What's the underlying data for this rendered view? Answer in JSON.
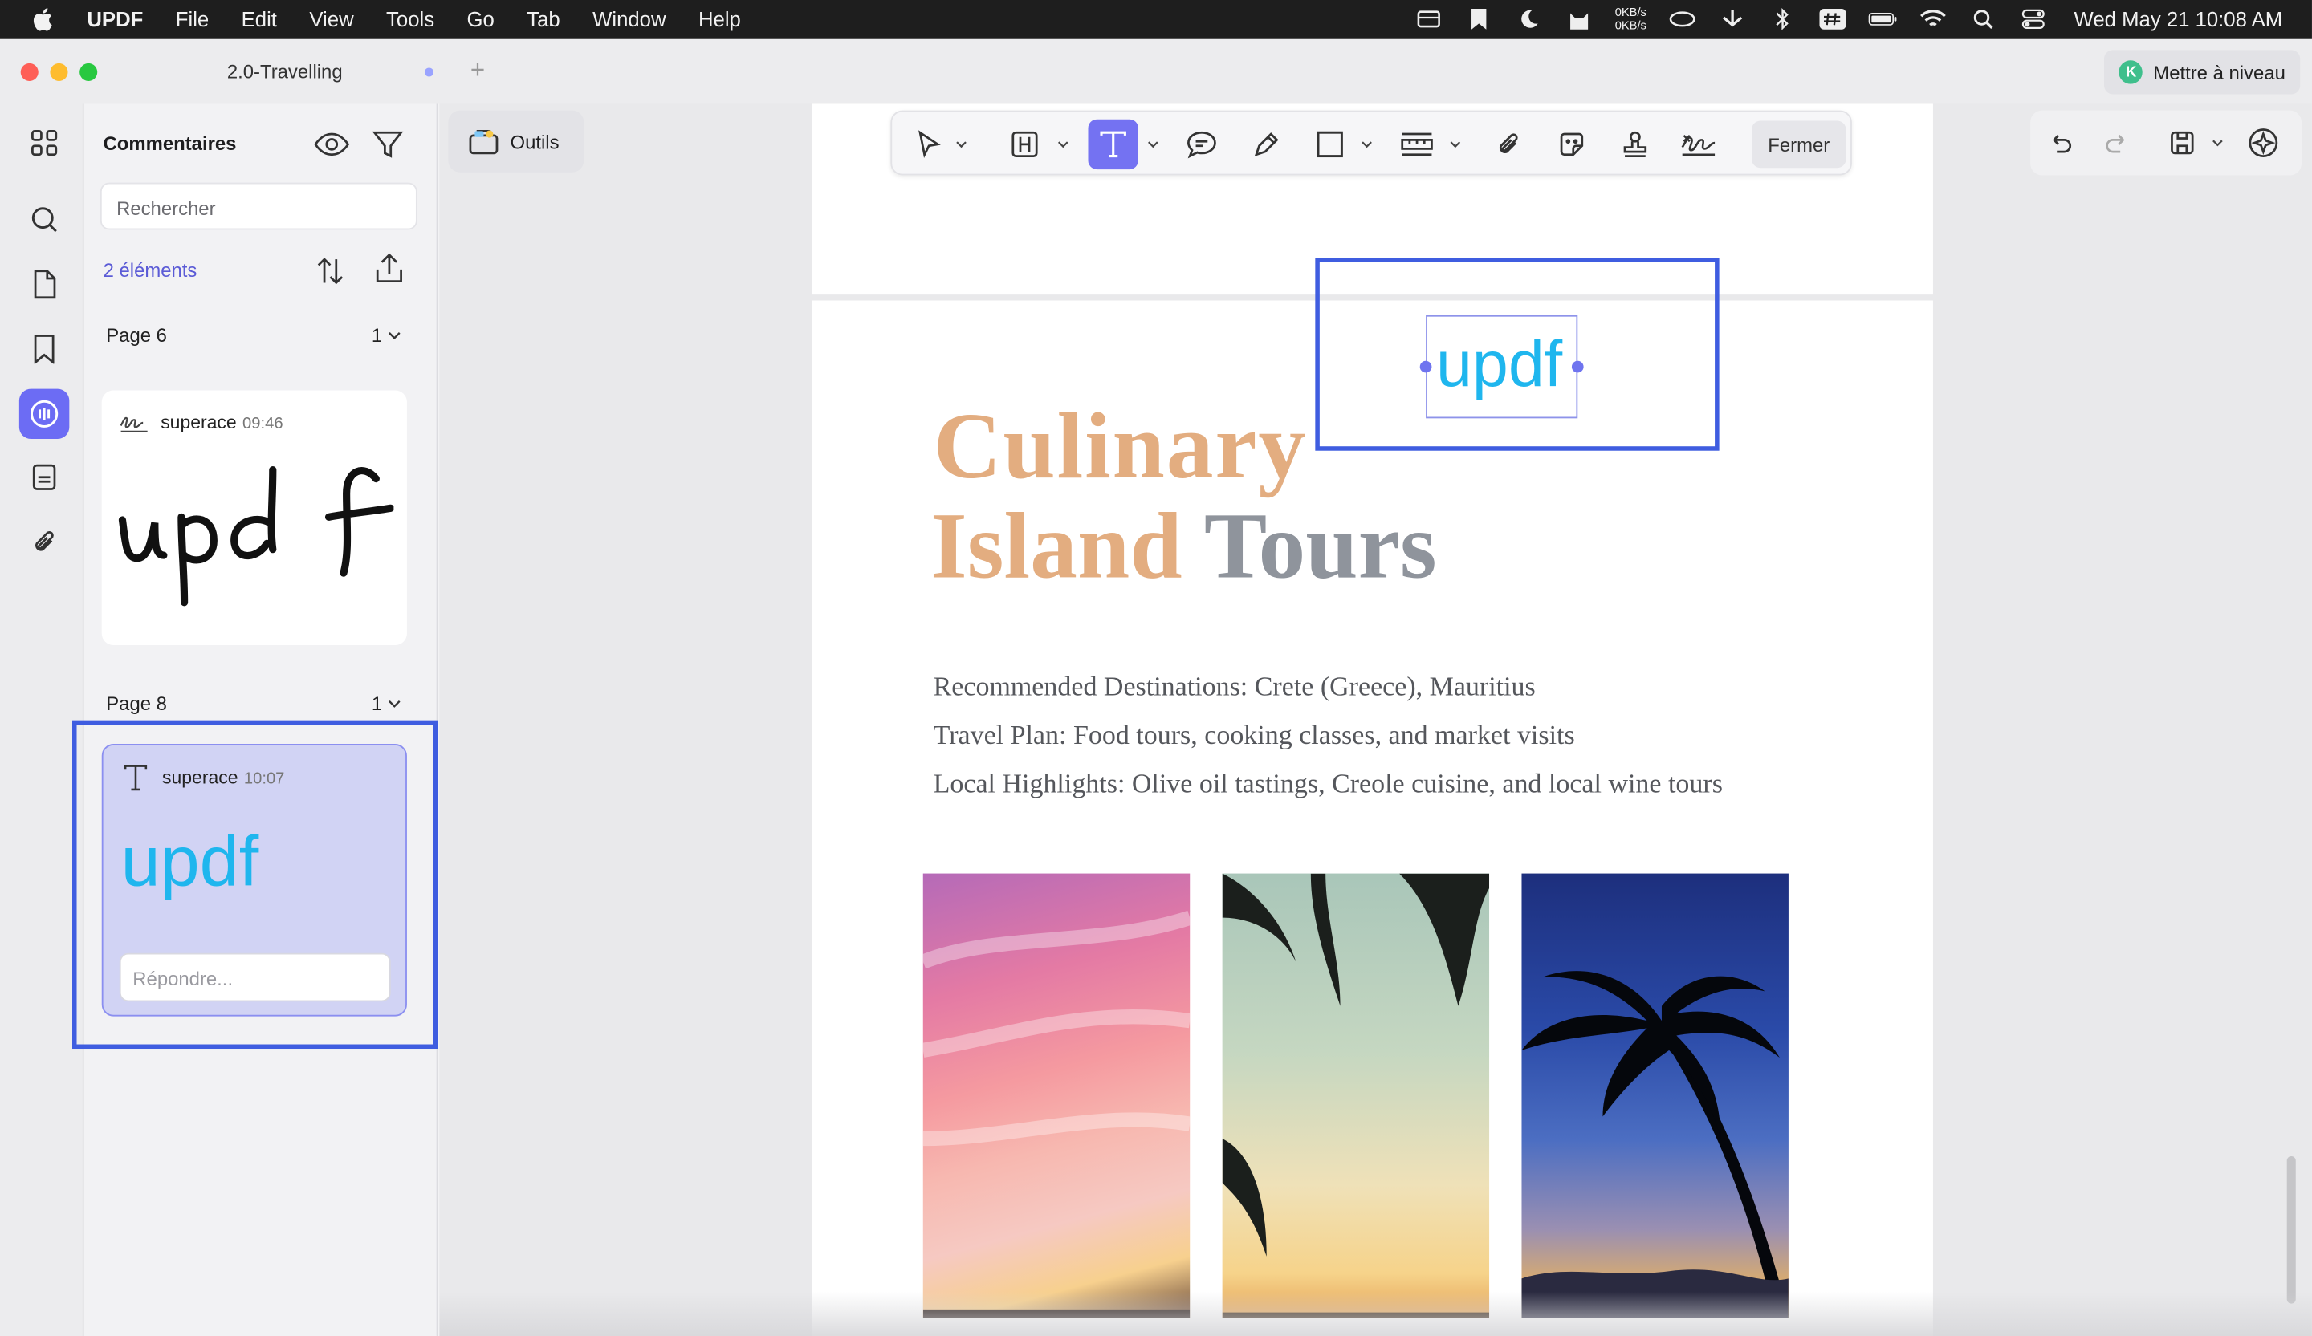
{
  "menubar": {
    "app_name": "UPDF",
    "menus": [
      "File",
      "Edit",
      "View",
      "Tools",
      "Go",
      "Tab",
      "Window",
      "Help"
    ],
    "net_up": "0KB/s",
    "net_down": "0KB/s",
    "clock": "Wed May 21  10:08 AM"
  },
  "window": {
    "tab_title": "2.0-Travelling",
    "upgrade_badge": "K",
    "upgrade_label": "Mettre à niveau"
  },
  "rail": {
    "icons": [
      "grid-icon",
      "search-icon",
      "pages-icon",
      "bookmark-icon",
      "comment-icon",
      "form-icon",
      "attachment-icon"
    ],
    "active": "comment-icon",
    "accent": "#6c6cf4"
  },
  "panel": {
    "title": "Commentaires",
    "search_placeholder": "Rechercher",
    "count_label": "2 éléments",
    "groups": [
      {
        "page_label": "Page 6",
        "count": "1",
        "comment": {
          "author": "superace",
          "time": "09:46",
          "content": "updf",
          "type": "signature"
        }
      },
      {
        "page_label": "Page 8",
        "count": "1",
        "comment": {
          "author": "superace",
          "time": "10:07",
          "content": "updf",
          "type": "text",
          "reply_placeholder": "Répondre..."
        }
      }
    ]
  },
  "toolbar": {
    "outils_label": "Outils",
    "fermer_label": "Fermer",
    "active_tool": "text-tool",
    "accent": "#7472f2"
  },
  "document": {
    "title_line1": "Culinary",
    "title_line2_a": "Island",
    "title_line2_b": "Tours",
    "lines": [
      "Recommended Destinations: Crete (Greece), Mauritius",
      "Travel Plan: Food tours, cooking classes, and market visits",
      "Local Highlights: Olive oil tastings, Creole cuisine, and local wine tours"
    ],
    "annotation_text": "updf",
    "annotation_color": "#1fb6ee",
    "title_color": "#e3ad80",
    "title_gray": "#8f949c"
  },
  "highlight_color": "#3f5de0"
}
